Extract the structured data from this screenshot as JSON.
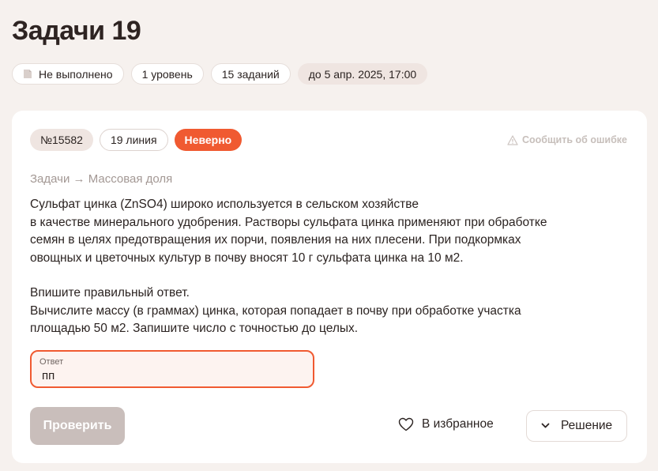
{
  "page": {
    "title": "Задачи 19"
  },
  "meta": {
    "status": "Не выполнено",
    "level": "1 уровень",
    "count": "15 заданий",
    "deadline": "до 5 апр. 2025, 17:00"
  },
  "task": {
    "number": "№15582",
    "line": "19 линия",
    "result": "Неверно",
    "report_label": "Сообщить об ошибке",
    "breadcrumb": "Задачи → Массовая доля",
    "text_lines": [
      "Сульфат цинка (ZnSO4) широко используется в сельском хозяйстве",
      "в качестве минерального удобрения. Растворы сульфата цинка применяют при обработке",
      "семян в целях предотвращения их порчи, появления на них плесени. При подкормках",
      "овощных и цветочных культур в почву вносят 10 г сульфата цинка на 10 м2."
    ],
    "question_lines": [
      "Впишите правильный ответ.",
      "Вычислите массу (в граммах) цинка, которая попадает в почву при обработке участка",
      "площадью 50 м2. Запишите число с точностью до целых."
    ]
  },
  "answer": {
    "label": "Ответ",
    "value": "пп"
  },
  "actions": {
    "check_label": "Проверить",
    "favorite_label": "В избранное",
    "solution_label": "Решение"
  },
  "colors": {
    "accent": "#f05a31",
    "background": "#f6f1ee",
    "disabled_button": "#c9bebb"
  },
  "icons": {
    "status": "document-icon",
    "report": "warning-triangle-icon",
    "favorite": "heart-icon",
    "solution": "chevron-down-icon"
  }
}
